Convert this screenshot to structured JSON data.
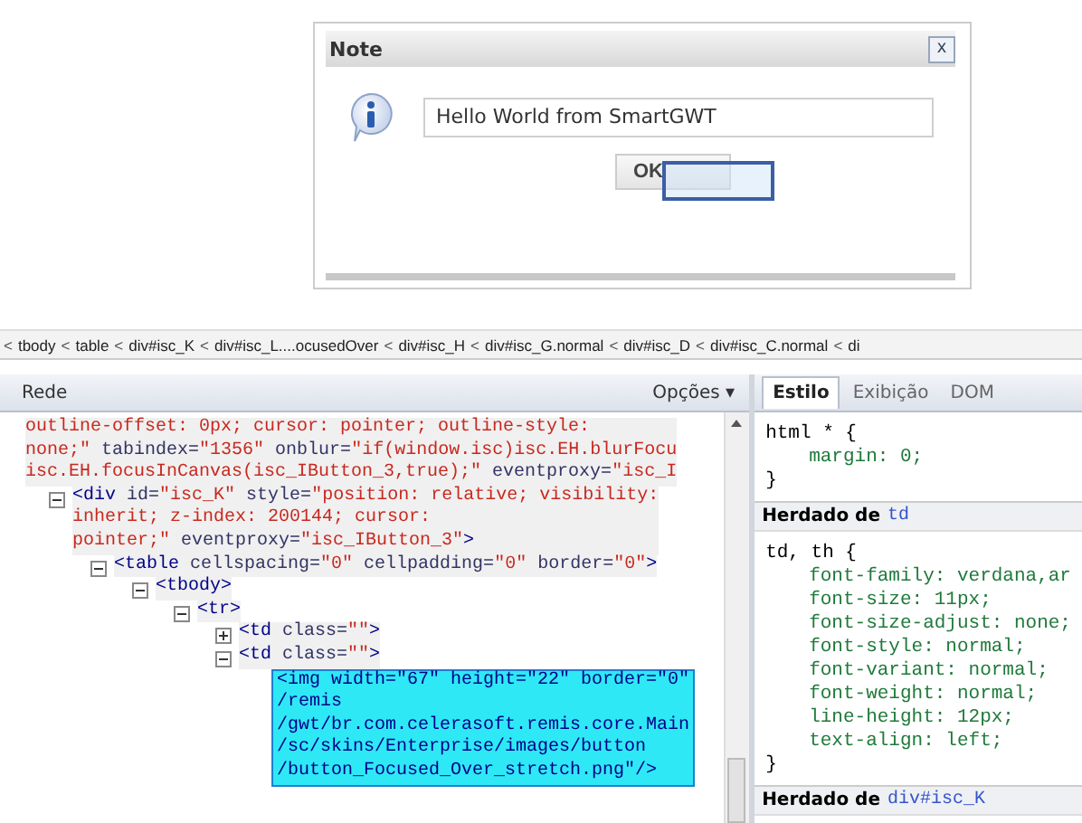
{
  "dialog": {
    "title": "Note",
    "close": "x",
    "message": "Hello World from SmartGWT",
    "button": "OK"
  },
  "breadcrumb_separator": "<",
  "breadcrumb": [
    "tbody",
    "table",
    "div#isc_K",
    "div#isc_L....ocusedOver",
    "div#isc_H",
    "div#isc_G.normal",
    "div#isc_D",
    "div#isc_C.normal",
    "di"
  ],
  "html_panel": {
    "title": "Rede",
    "options": "Opções ▾",
    "tree": [
      {
        "highlighted": false,
        "lines": [
          [
            {
              "kind": "value",
              "text": "outline-offset: 0px; cursor: pointer; outline-style:"
            }
          ],
          [
            {
              "kind": "value",
              "text": "none;\""
            },
            {
              "kind": "attr",
              "text": " tabindex="
            },
            {
              "kind": "value",
              "text": "\"1356\""
            },
            {
              "kind": "attr",
              "text": " onblur="
            },
            {
              "kind": "value",
              "text": "\"if(window.isc)isc.EH.blurFocu"
            }
          ],
          [
            {
              "kind": "value",
              "text": "isc.EH.focusInCanvas(isc_IButton_3,true);\""
            },
            {
              "kind": "attr",
              "text": " eventproxy="
            },
            {
              "kind": "value",
              "text": "\"isc_I"
            }
          ]
        ],
        "children": [
          {
            "expanded": true,
            "highlighted": false,
            "lines": [
              [
                {
                  "kind": "tag",
                  "text": "<div"
                },
                {
                  "kind": "attr",
                  "text": " id="
                },
                {
                  "kind": "value",
                  "text": "\"isc_K\""
                },
                {
                  "kind": "attr",
                  "text": " style="
                },
                {
                  "kind": "value",
                  "text": "\"position: relative; visibility:"
                }
              ],
              [
                {
                  "kind": "value",
                  "text": "inherit; z-index: 200144; cursor:"
                }
              ],
              [
                {
                  "kind": "value",
                  "text": "pointer;\""
                },
                {
                  "kind": "attr",
                  "text": " eventproxy="
                },
                {
                  "kind": "value",
                  "text": "\"isc_IButton_3\""
                },
                {
                  "kind": "tag",
                  "text": ">"
                }
              ]
            ],
            "children": [
              {
                "expanded": true,
                "highlighted": false,
                "lines": [
                  [
                    {
                      "kind": "tag",
                      "text": "<table"
                    },
                    {
                      "kind": "attr",
                      "text": " cellspacing="
                    },
                    {
                      "kind": "value",
                      "text": "\"0\""
                    },
                    {
                      "kind": "attr",
                      "text": " cellpadding="
                    },
                    {
                      "kind": "value",
                      "text": "\"0\""
                    },
                    {
                      "kind": "attr",
                      "text": " border="
                    },
                    {
                      "kind": "value",
                      "text": "\"0\""
                    },
                    {
                      "kind": "tag",
                      "text": ">"
                    }
                  ]
                ],
                "children": [
                  {
                    "expanded": true,
                    "highlighted": false,
                    "lines": [
                      [
                        {
                          "kind": "tag",
                          "text": "<tbody>"
                        }
                      ]
                    ],
                    "children": [
                      {
                        "expanded": true,
                        "highlighted": false,
                        "lines": [
                          [
                            {
                              "kind": "tag",
                              "text": "<tr>"
                            }
                          ]
                        ],
                        "children": [
                          {
                            "expanded": false,
                            "highlighted": false,
                            "lines": [
                              [
                                {
                                  "kind": "tag",
                                  "text": "<td"
                                },
                                {
                                  "kind": "attr",
                                  "text": " class="
                                },
                                {
                                  "kind": "value",
                                  "text": "\"\""
                                },
                                {
                                  "kind": "tag",
                                  "text": ">"
                                }
                              ]
                            ]
                          },
                          {
                            "expanded": true,
                            "highlighted": false,
                            "lines": [
                              [
                                {
                                  "kind": "tag",
                                  "text": "<td"
                                },
                                {
                                  "kind": "attr",
                                  "text": " class="
                                },
                                {
                                  "kind": "value",
                                  "text": "\"\""
                                },
                                {
                                  "kind": "tag",
                                  "text": ">"
                                }
                              ]
                            ],
                            "children": [
                              {
                                "highlighted": true,
                                "lines": [
                                  [
                                    {
                                      "kind": "tag",
                                      "text": "<img width=\"67\" height=\"22\" border=\"0\""
                                    }
                                  ],
                                  [
                                    {
                                      "kind": "tag",
                                      "text": "/remis"
                                    }
                                  ],
                                  [
                                    {
                                      "kind": "tag",
                                      "text": "/gwt/br.com.celerasoft.remis.core.Main"
                                    }
                                  ],
                                  [
                                    {
                                      "kind": "tag",
                                      "text": "/sc/skins/Enterprise/images/button"
                                    }
                                  ],
                                  [
                                    {
                                      "kind": "tag",
                                      "text": "/button_Focused_Over_stretch.png\"/>"
                                    }
                                  ]
                                ]
                              }
                            ]
                          }
                        ]
                      }
                    ]
                  }
                ]
              }
            ]
          }
        ]
      }
    ]
  },
  "style_panel": {
    "tabs": [
      {
        "label": "Estilo",
        "selected": true
      },
      {
        "label": "Exibição",
        "selected": false
      },
      {
        "label": "DOM",
        "selected": false
      }
    ],
    "sections": [
      {
        "kind": "rule",
        "selector": "html * {",
        "declarations": [
          "margin: 0;"
        ],
        "close": "}"
      },
      {
        "kind": "inherited",
        "prefix": "Herdado de",
        "element": "td"
      },
      {
        "kind": "rule",
        "selector": "td, th {",
        "declarations": [
          "font-family: verdana,ar",
          "font-size: 11px;",
          "font-size-adjust: none;",
          "font-style: normal;",
          "font-variant: normal;",
          "font-weight: normal;",
          "line-height: 12px;",
          "text-align: left;"
        ],
        "close": "}"
      },
      {
        "kind": "inherited",
        "prefix": "Herdado de",
        "element": "div#isc_K"
      }
    ]
  }
}
